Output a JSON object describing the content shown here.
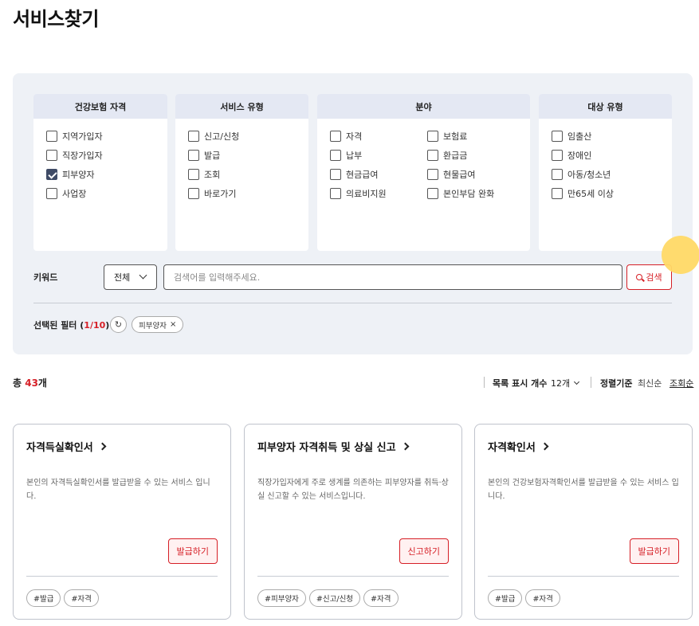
{
  "page": {
    "title": "서비스찾기"
  },
  "filters": {
    "groups": [
      {
        "title": "건강보험 자격",
        "options": [
          {
            "label": "지역가입자",
            "checked": false
          },
          {
            "label": "직장가입자",
            "checked": false
          },
          {
            "label": "피부양자",
            "checked": true
          },
          {
            "label": "사업장",
            "checked": false
          }
        ]
      },
      {
        "title": "서비스 유형",
        "options": [
          {
            "label": "신고/신청",
            "checked": false
          },
          {
            "label": "발급",
            "checked": false
          },
          {
            "label": "조회",
            "checked": false
          },
          {
            "label": "바로가기",
            "checked": false
          }
        ]
      },
      {
        "title": "분야",
        "options": [
          {
            "label": "자격",
            "checked": false
          },
          {
            "label": "보험료",
            "checked": false
          },
          {
            "label": "납부",
            "checked": false
          },
          {
            "label": "환급금",
            "checked": false
          },
          {
            "label": "현금급여",
            "checked": false
          },
          {
            "label": "현물급여",
            "checked": false
          },
          {
            "label": "의료비지원",
            "checked": false
          },
          {
            "label": "본인부담 완화",
            "checked": false
          }
        ]
      },
      {
        "title": "대상 유형",
        "options": [
          {
            "label": "임출산",
            "checked": false
          },
          {
            "label": "장애인",
            "checked": false
          },
          {
            "label": "아동/청소년",
            "checked": false
          },
          {
            "label": "만65세 이상",
            "checked": false
          }
        ]
      }
    ],
    "keyword": {
      "label": "키워드",
      "scope": "전체",
      "placeholder": "검색어를 입력해주세요.",
      "value": "",
      "search_label": "검색"
    },
    "selected": {
      "label": "선택된 필터",
      "open": " (",
      "count": "1/10",
      "close": ")",
      "chips": [
        "피부양자"
      ],
      "reset_icon": "refresh-icon"
    }
  },
  "results": {
    "total_prefix": "총 ",
    "total_count": "43",
    "total_suffix": "개",
    "per_page_label": "목록 표시 개수",
    "per_page_value": "12개",
    "sort_label": "정렬기준",
    "sort_options": [
      "최신순",
      "조회순"
    ],
    "sort_selected": "조회순"
  },
  "cards": [
    {
      "title": "자격득실확인서",
      "description": "본인의 자격득실확인서를 발급받을 수 있는 서비스 입니다.",
      "button": "발급하기",
      "tags": [
        "#발급",
        "#자격"
      ]
    },
    {
      "title": "피부양자 자격취득 및 상실 신고",
      "description": "직장가입자에게 주로 생계를 의존하는 피부양자를 취득·상실 신고할 수 있는 서비스입니다.",
      "button": "신고하기",
      "tags": [
        "#피부양자",
        "#신고/신청",
        "#자격"
      ]
    },
    {
      "title": "자격확인서",
      "description": "본인의 건강보험자격확인서를 발급받을 수 있는 서비스 입니다.",
      "button": "발급하기",
      "tags": [
        "#발급",
        "#자격"
      ]
    }
  ],
  "colors": {
    "accent": "#d61f26",
    "panel_bg": "#eef1f6",
    "box_head": "#e4e8f3",
    "checked": "#3f4b66"
  }
}
